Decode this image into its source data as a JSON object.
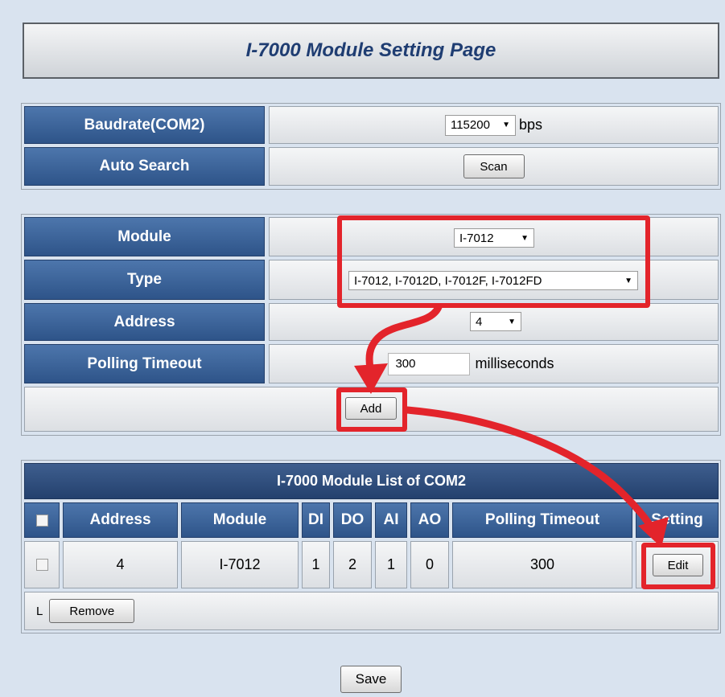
{
  "page_title": "I-7000 Module Setting Page",
  "baudrate": {
    "label": "Baudrate(COM2)",
    "value": "115200",
    "unit": "bps"
  },
  "auto_search": {
    "label": "Auto Search",
    "button": "Scan"
  },
  "module": {
    "label": "Module",
    "value": "I-7012"
  },
  "type": {
    "label": "Type",
    "value": "I-7012, I-7012D, I-7012F, I-7012FD"
  },
  "address": {
    "label": "Address",
    "value": "4"
  },
  "polling": {
    "label": "Polling Timeout",
    "value": "300",
    "unit": "milliseconds"
  },
  "add_button": "Add",
  "list": {
    "title": "I-7000 Module List of COM2",
    "columns": [
      "Address",
      "Module",
      "DI",
      "DO",
      "AI",
      "AO",
      "Polling Timeout",
      "Setting"
    ],
    "rows": [
      {
        "address": "4",
        "module": "I-7012",
        "di": "1",
        "do": "2",
        "ai": "1",
        "ao": "0",
        "polling": "300",
        "setting": "Edit"
      }
    ],
    "remove_prefix": "L",
    "remove_button": "Remove"
  },
  "save_button": "Save",
  "colors": {
    "header_blue": "#2e5489",
    "highlight_red": "#e3242b",
    "background": "#d9e3ef"
  }
}
